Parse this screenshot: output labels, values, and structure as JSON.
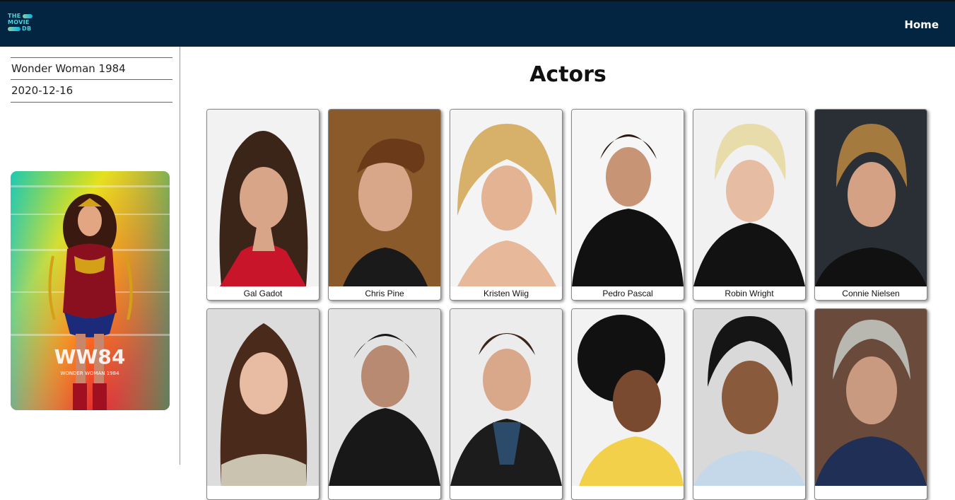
{
  "header": {
    "logo_lines": [
      "THE",
      "MOVIE",
      "DB"
    ],
    "home_label": "Home"
  },
  "movie": {
    "title": "Wonder Woman 1984",
    "release_date": "2020-12-16",
    "poster_text": "WW84",
    "poster_subtext": "WONDER WOMAN 1984"
  },
  "main": {
    "title": "Actors"
  },
  "actors": [
    {
      "name": "Gal Gadot"
    },
    {
      "name": "Chris Pine"
    },
    {
      "name": "Kristen Wiig"
    },
    {
      "name": "Pedro Pascal"
    },
    {
      "name": "Robin Wright"
    },
    {
      "name": "Connie Nielsen"
    },
    {
      "name": ""
    },
    {
      "name": ""
    },
    {
      "name": ""
    },
    {
      "name": ""
    },
    {
      "name": ""
    },
    {
      "name": ""
    }
  ],
  "colors": {
    "header_bg": "#032541",
    "tmdb_accent": "#01b4e4"
  }
}
